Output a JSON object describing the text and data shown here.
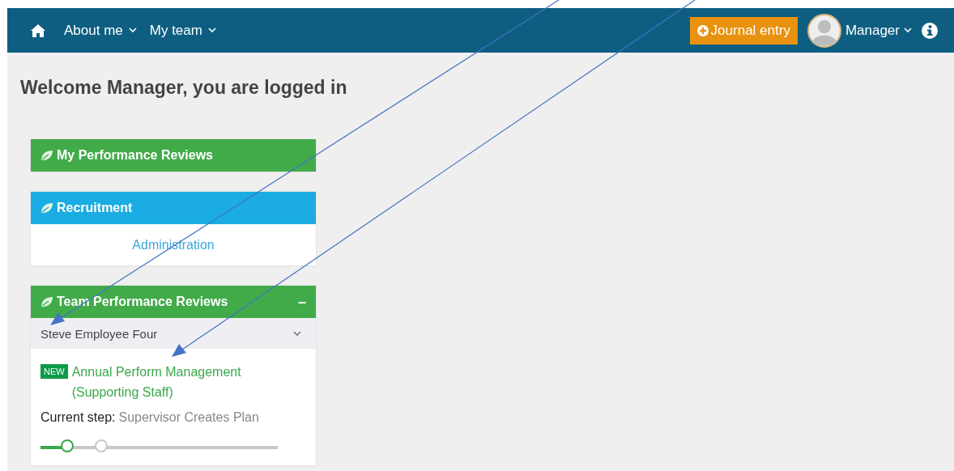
{
  "navbar": {
    "menus": [
      {
        "label": "About me"
      },
      {
        "label": "My team"
      }
    ],
    "journal_button": "Journal entry",
    "user": "Manager"
  },
  "heading": "Welcome Manager, you are logged in",
  "cards": [
    {
      "title": "My Performance Reviews",
      "color": "#41ab4a"
    },
    {
      "title": "Recruitment",
      "color": "#1aace2",
      "links": [
        "Administration"
      ]
    },
    {
      "title": "Team Performance Reviews",
      "color": "#41ab4a",
      "collapse": "–",
      "employee": "Steve Employee Four",
      "review": {
        "badge": "NEW",
        "title": "Annual Perform Management (Supporting Staff)",
        "step_label": "Current step:",
        "step": "Supervisor Creates Plan",
        "level": 0.11,
        "steps": [
          {
            "selected": true
          },
          {
            "selected": false
          }
        ]
      }
    }
  ]
}
